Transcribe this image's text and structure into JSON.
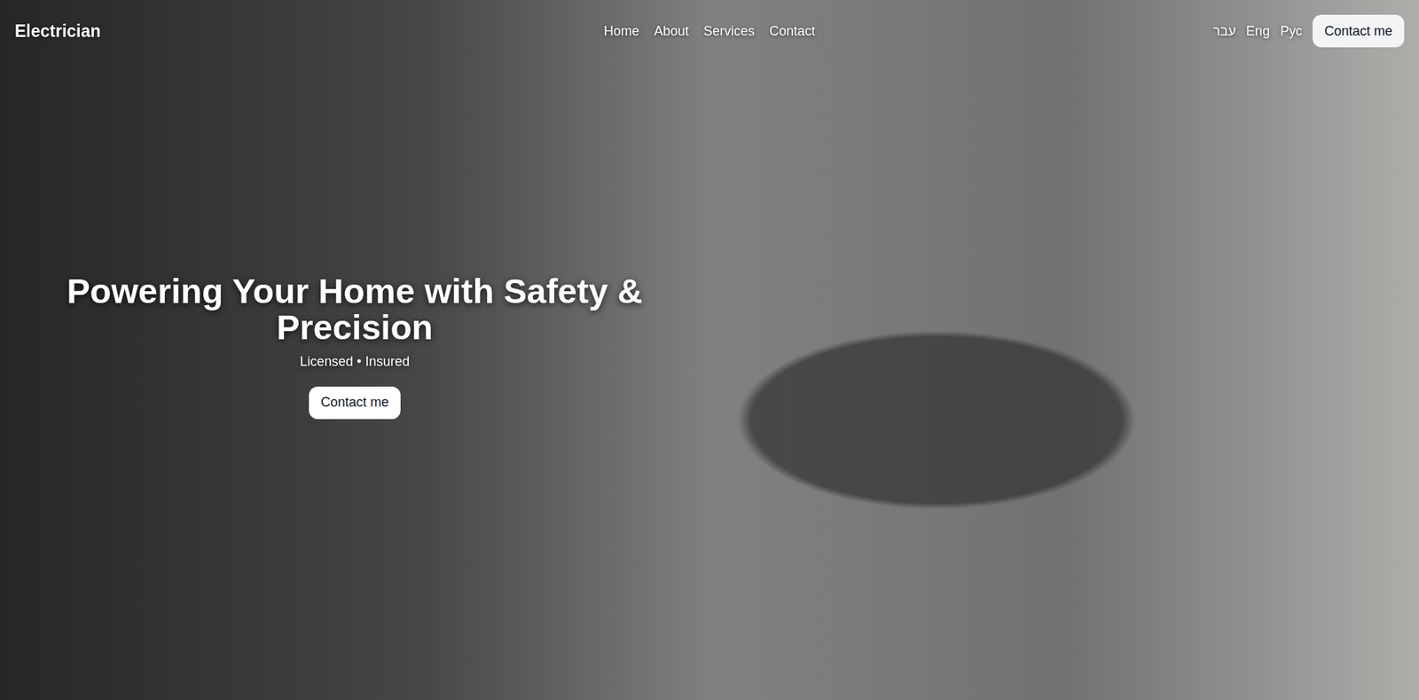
{
  "header": {
    "logo": "Electrician",
    "nav": [
      {
        "label": "Home"
      },
      {
        "label": "About"
      },
      {
        "label": "Services"
      },
      {
        "label": "Contact"
      }
    ],
    "languages": [
      {
        "label": "עבר"
      },
      {
        "label": "Eng"
      },
      {
        "label": "Рус"
      }
    ],
    "cta": "Contact me"
  },
  "hero": {
    "title": "Powering Your Home with Safety & Precision",
    "subtitle": "Licensed • Insured",
    "button": "Contact me"
  }
}
